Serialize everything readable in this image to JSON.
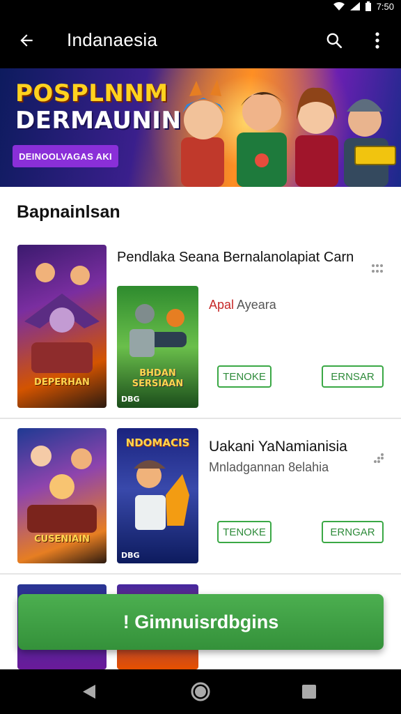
{
  "status_bar": {
    "time": "7:50"
  },
  "app_bar": {
    "title": "Indanaesia"
  },
  "banner": {
    "title_line1": "POSPLNNM",
    "title_line2": "DERMAUNIN",
    "cta_label": "DEINOOLVAGAS AKI"
  },
  "section": {
    "title": "Bapnainlsan"
  },
  "items": [
    {
      "title": "Pendlaka Seana Bernalanolapiat Carn",
      "subtitle_accent": "Apal",
      "subtitle_rest": " Ayeara",
      "cover_a_label": "DEPERHAN",
      "cover_b_label": "BHDAN SERSIAAN",
      "cover_b_footer": "DBG",
      "button_primary": "TENOKE",
      "button_secondary": "ERNSAR"
    },
    {
      "title": "Uakani YaNamianisia",
      "subtitle": "Mnladgannan 8elahia",
      "cover_a_label": "CUSENIAIN",
      "cover_b_label": "NDOMACIS",
      "cover_b_footer": "DBG",
      "button_primary": "TENOKE",
      "button_secondary": "ERNGAR"
    }
  ],
  "fab": {
    "label": "! Gimnuisrdbgins"
  },
  "icons": {
    "back": "arrow-back-icon",
    "search": "search-icon",
    "more": "more-vert-icon",
    "drag": "drag-handle-icon",
    "nav_back": "nav-back-icon",
    "nav_home": "nav-home-icon",
    "nav_recents": "nav-recents-icon"
  },
  "colors": {
    "accent_green": "#3aa845",
    "banner_purple": "#8a2fd8",
    "subtitle_red": "#c62828"
  }
}
